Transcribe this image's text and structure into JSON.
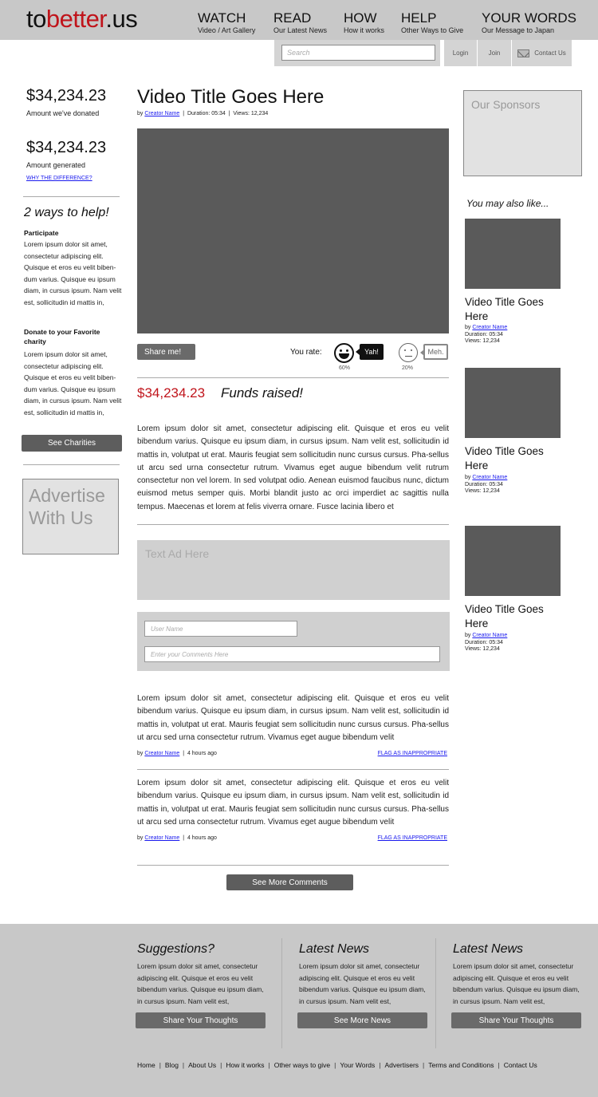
{
  "header": {
    "logo_prefix": "to",
    "logo_accent": "better",
    "logo_suffix": ".us",
    "nav": [
      {
        "label": "WATCH",
        "sub": "Video / Art Gallery"
      },
      {
        "label": "READ",
        "sub": "Our Latest News"
      },
      {
        "label": "HOW",
        "sub": "How it works"
      },
      {
        "label": "HELP",
        "sub": "Other Ways to Give"
      },
      {
        "label": "YOUR WORDS",
        "sub": "Our Message to Japan"
      }
    ],
    "search_placeholder": "Search",
    "login": "Login",
    "join": "Join",
    "contact": "Contact Us"
  },
  "left": {
    "donated_amount": "$34,234.23",
    "donated_label": "Amount we've donated",
    "generated_amount": "$34,234.23",
    "generated_label": "Amount generated",
    "why_link": "WHY THE DIFFERENCE?",
    "ways_title": "2 ways to help!",
    "participate_title": "Participate",
    "participate_text": "Lorem ipsum dolor sit amet, consectetur adipiscing elit. Quisque et eros eu velit biben-dum varius. Quisque eu ipsum diam, in cursus ipsum. Nam velit est, sollicitudin id mattis in,",
    "donate_title": "Donate to your Favorite charity",
    "donate_text": "Lorem ipsum dolor sit amet, consectetur adipiscing elit. Quisque et eros eu velit biben-dum varius. Quisque eu ipsum diam, in cursus ipsum. Nam velit est, sollicitudin id mattis in,",
    "see_charities": "See Charities",
    "advertise": "Advertise With Us"
  },
  "video": {
    "title": "Video Title Goes Here",
    "by": "by",
    "creator": "Creator Name",
    "sep": "|",
    "duration": "Duration: 05:34",
    "views": "Views: 12,234",
    "share": "Share me!",
    "you_rate": "You rate:",
    "yah": "Yah!",
    "meh": "Meh.",
    "yah_pct": "60%",
    "meh_pct": "20%",
    "funds_amount": "$34,234.23",
    "funds_label": "Funds raised!",
    "description": "Lorem ipsum dolor sit amet, consectetur adipiscing elit. Quisque et eros eu velit bibendum varius. Quisque eu ipsum diam, in cursus ipsum. Nam velit est, sollicitudin id mattis in, volutpat ut erat. Mauris feugiat sem sollicitudin nunc cursus cursus. Pha-sellus ut arcu sed urna consectetur rutrum. Vivamus eget augue bibendum velit rutrum consectetur non vel lorem. In sed volutpat odio. Aenean euismod faucibus nunc, dictum euismod metus semper quis. Morbi blandit justo ac orci imperdiet ac sagittis nulla tempus. Maecenas et lorem at felis viverra ornare. Fusce lacinia libero et"
  },
  "text_ad": "Text Ad Here",
  "comment_form": {
    "username_placeholder": "User Name",
    "comment_placeholder": "Enter your Comments Here"
  },
  "comments": [
    {
      "text": "Lorem ipsum dolor sit amet, consectetur adipiscing elit. Quisque et eros eu velit bibendum varius. Quisque eu ipsum diam, in cursus ipsum. Nam velit est, sollicitudin id mattis in, volutpat ut erat. Mauris feugiat sem sollicitudin nunc cursus cursus. Pha-sellus ut arcu sed urna consectetur rutrum. Vivamus eget augue bibendum velit",
      "by": "by",
      "author": "Creator Name",
      "sep": "|",
      "time": "4 hours ago",
      "flag": "FLAG AS INAPPROPRIATE"
    },
    {
      "text": "Lorem ipsum dolor sit amet, consectetur adipiscing elit. Quisque et eros eu velit bibendum varius. Quisque eu ipsum diam, in cursus ipsum. Nam velit est, sollicitudin id mattis in, volutpat ut erat. Mauris feugiat sem sollicitudin nunc cursus cursus. Pha-sellus ut arcu sed urna consectetur rutrum. Vivamus eget augue bibendum velit",
      "by": "by",
      "author": "Creator Name",
      "sep": "|",
      "time": "4 hours ago",
      "flag": "FLAG AS INAPPROPRIATE"
    }
  ],
  "see_more_comments": "See More Comments",
  "right": {
    "sponsors": "Our Sponsors",
    "also_like": "You may also like...",
    "related": [
      {
        "title": "Video Title Goes Here",
        "by": "by",
        "creator": "Creator Name",
        "duration": "Duration: 05:34",
        "views": "Views: 12,234"
      },
      {
        "title": "Video Title Goes Here",
        "by": "by",
        "creator": "Creator Name",
        "duration": "Duration: 05:34",
        "views": "Views: 12,234"
      },
      {
        "title": "Video Title Goes Here",
        "by": "by",
        "creator": "Creator Name",
        "duration": "Duration: 05:34",
        "views": "Views: 12,234"
      }
    ]
  },
  "footer": {
    "columns": [
      {
        "title": "Suggestions?",
        "text": "Lorem ipsum dolor sit amet, consectetur adipiscing elit. Quisque et eros eu velit bibendum varius. Quisque eu ipsum diam, in cursus ipsum. Nam velit est,",
        "button": "Share Your Thoughts"
      },
      {
        "title": "Latest News",
        "text": "Lorem ipsum dolor sit amet, consectetur adipiscing elit. Quisque et eros eu velit bibendum varius. Quisque eu ipsum diam, in cursus ipsum. Nam velit est,",
        "button": "See More News"
      },
      {
        "title": "Latest News",
        "text": "Lorem ipsum dolor sit amet, consectetur adipiscing elit. Quisque et eros eu velit bibendum varius. Quisque eu ipsum diam, in cursus ipsum. Nam velit est,",
        "button": "Share Your Thoughts"
      }
    ],
    "links": [
      "Home",
      "Blog",
      "About Us",
      "How it works",
      "Other ways to give",
      "Your Words",
      "Advertisers",
      "Terms and Conditions",
      "Contact Us"
    ],
    "link_sep": "|"
  }
}
